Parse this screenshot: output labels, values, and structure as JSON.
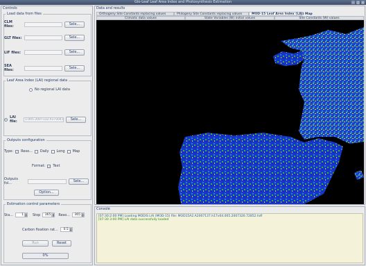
{
  "window": {
    "title": "Glo-Leaf Leaf Area Index and Photosynthesis Estimation"
  },
  "controls": {
    "title": "Controls",
    "load": {
      "legend": "Load data from files",
      "rows": [
        {
          "label": "CLM files:",
          "value": "",
          "button": "Sele..."
        },
        {
          "label": "GLT files:",
          "value": "",
          "button": "Sele..."
        },
        {
          "label": "LIF files:",
          "value": "",
          "button": "Sele..."
        },
        {
          "label": "SEA files:",
          "value": "",
          "button": "Sele..."
        }
      ]
    },
    "lai": {
      "legend": "Leaf Area Index (LAI) regional data",
      "radio_none": "No regional LAI data",
      "lai_label": "LAI file:",
      "lai_value": "1.005.2007132.h17v04.hdf",
      "button": "Sele..."
    },
    "outputs": {
      "legend": "Outputs configuration",
      "type_label": "Type:",
      "types": [
        "Reso...",
        "Daily",
        "Long",
        "Map"
      ],
      "format_label": "Format:",
      "format_value": "Text",
      "folder_label": "Outputs fol...",
      "folder_button": "Sele...",
      "options_button": "Option..."
    },
    "estimation": {
      "legend": "Estimation control parameters",
      "sta_label": "Sta...",
      "sta_value": "1",
      "stop_label": "Stop",
      "stop_value": "365",
      "reso_label": "Reso...",
      "reso_value": "365",
      "carbon_label": "Carbon fixation rat...",
      "carbon_value": "0.5",
      "run_button": "Run",
      "reset_button": "Reset",
      "progress_text": "0%",
      "progress": 0
    }
  },
  "results": {
    "title": "Data and results",
    "tabs_top": [
      "Orthogeny Site Constants replacing values",
      "Philogeny Site Constants replacing values",
      "MOD-15 Leaf Area Index (LAI) Map"
    ],
    "tabs_bottom": [
      "Climatic data values",
      "State Variables (W) initial values",
      "Site Constants (W) values"
    ]
  },
  "console": {
    "title": "Console",
    "lines": [
      "[07:30:2:00 PM] Loading MODIS LAI (MOD-15) file: MOD15A2.A2007137.h17v04.005.2007320.72852.hdf",
      "[07:30 3:00 PM] LAI data successfully loaded"
    ]
  }
}
